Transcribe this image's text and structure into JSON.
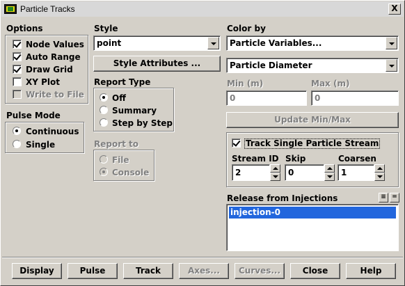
{
  "window": {
    "title": "Particle Tracks",
    "close_label": "X"
  },
  "options": {
    "heading": "Options",
    "items": [
      {
        "label": "Node Values",
        "checked": true,
        "enabled": true
      },
      {
        "label": "Auto Range",
        "checked": true,
        "enabled": true
      },
      {
        "label": "Draw Grid",
        "checked": true,
        "enabled": true
      },
      {
        "label": "XY Plot",
        "checked": false,
        "enabled": true
      },
      {
        "label": "Write to File",
        "checked": false,
        "enabled": false
      }
    ]
  },
  "pulse_mode": {
    "heading": "Pulse Mode",
    "items": [
      {
        "label": "Continuous",
        "selected": true
      },
      {
        "label": "Single",
        "selected": false
      }
    ]
  },
  "style": {
    "heading": "Style",
    "value": "point",
    "attributes_button": "Style Attributes ..."
  },
  "report_type": {
    "heading": "Report Type",
    "items": [
      {
        "label": "Off",
        "selected": true
      },
      {
        "label": "Summary",
        "selected": false
      },
      {
        "label": "Step by Step",
        "selected": false
      }
    ]
  },
  "report_to": {
    "heading": "Report to",
    "items": [
      {
        "label": "File",
        "selected": false
      },
      {
        "label": "Console",
        "selected": true
      }
    ]
  },
  "color_by": {
    "heading": "Color by",
    "category": "Particle Variables...",
    "variable": "Particle Diameter",
    "min_label": "Min (m)",
    "max_label": "Max (m)",
    "min_value": "0",
    "max_value": "0",
    "update_button": "Update Min/Max"
  },
  "track_single": {
    "label": "Track Single Particle Stream",
    "checked": true,
    "stream_id_label": "Stream ID",
    "skip_label": "Skip",
    "coarsen_label": "Coarsen",
    "stream_id": "2",
    "skip": "0",
    "coarsen": "1"
  },
  "release": {
    "heading": "Release from Injections",
    "items": [
      "injection-0"
    ],
    "select_all_icon": "list-select-all-icon",
    "deselect_icon": "list-deselect-icon"
  },
  "buttons": {
    "display": "Display",
    "pulse": "Pulse",
    "track": "Track",
    "axes": "Axes...",
    "curves": "Curves...",
    "close": "Close",
    "help": "Help"
  }
}
